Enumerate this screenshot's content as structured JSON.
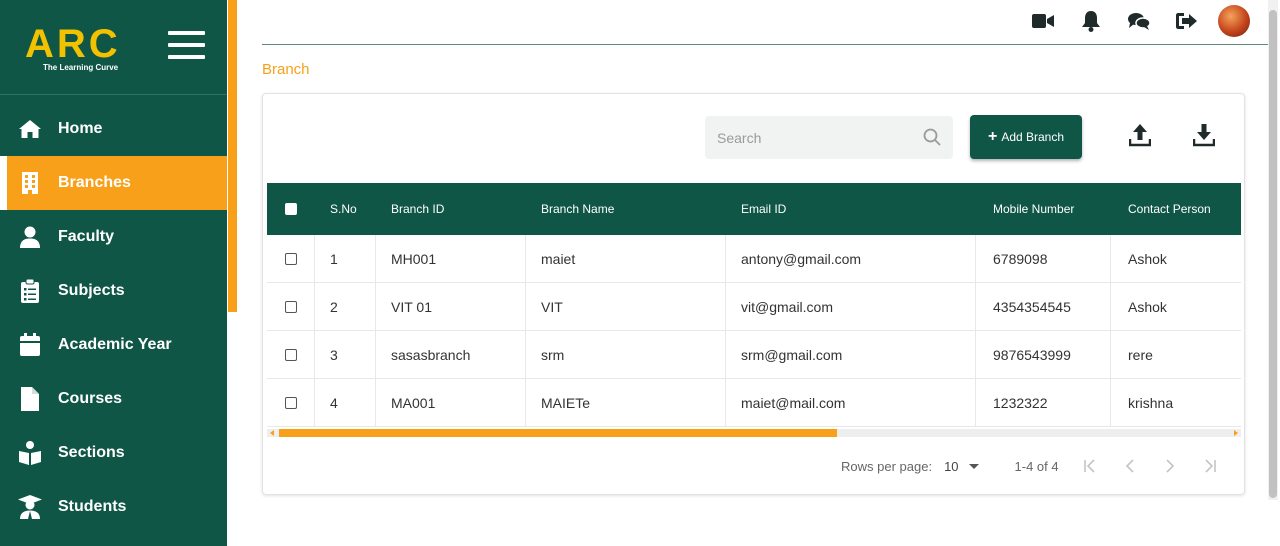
{
  "brand": {
    "logo": "ARC",
    "tagline": "The Learning Curve"
  },
  "sidebar": {
    "items": [
      {
        "label": "Home",
        "icon": "home-icon"
      },
      {
        "label": "Branches",
        "icon": "building-icon",
        "active": true
      },
      {
        "label": "Faculty",
        "icon": "user-icon"
      },
      {
        "label": "Subjects",
        "icon": "clipboard-icon"
      },
      {
        "label": "Academic Year",
        "icon": "calendar-icon"
      },
      {
        "label": "Courses",
        "icon": "file-icon"
      },
      {
        "label": "Sections",
        "icon": "reader-icon"
      },
      {
        "label": "Students",
        "icon": "graduate-icon"
      }
    ]
  },
  "header": {
    "icons": [
      "video-icon",
      "bell-icon",
      "chat-icon",
      "logout-icon",
      "avatar"
    ]
  },
  "breadcrumb": "Branch",
  "toolbar": {
    "search_placeholder": "Search",
    "add_label": "Add Branch",
    "upload_icon": "upload-icon",
    "download_icon": "download-icon"
  },
  "table": {
    "columns": [
      "S.No",
      "Branch ID",
      "Branch Name",
      "Email ID",
      "Mobile Number",
      "Contact Person"
    ],
    "rows": [
      [
        "1",
        "MH001",
        "maiet",
        "antony@gmail.com",
        "6789098",
        "Ashok"
      ],
      [
        "2",
        "VIT 01",
        "VIT",
        "vit@gmail.com",
        "4354354545",
        "Ashok"
      ],
      [
        "3",
        "sasasbranch",
        "srm",
        "srm@gmail.com",
        "9876543999",
        "rere"
      ],
      [
        "4",
        "MA001",
        "MAIETe",
        "maiet@mail.com",
        "1232322",
        "krishna"
      ]
    ]
  },
  "pagination": {
    "rows_per_page_label": "Rows per page:",
    "rows_per_page": "10",
    "range": "1-4 of 4"
  },
  "colors": {
    "primary": "#0f5646",
    "accent": "#f9a01b",
    "logo": "#f2c200"
  }
}
